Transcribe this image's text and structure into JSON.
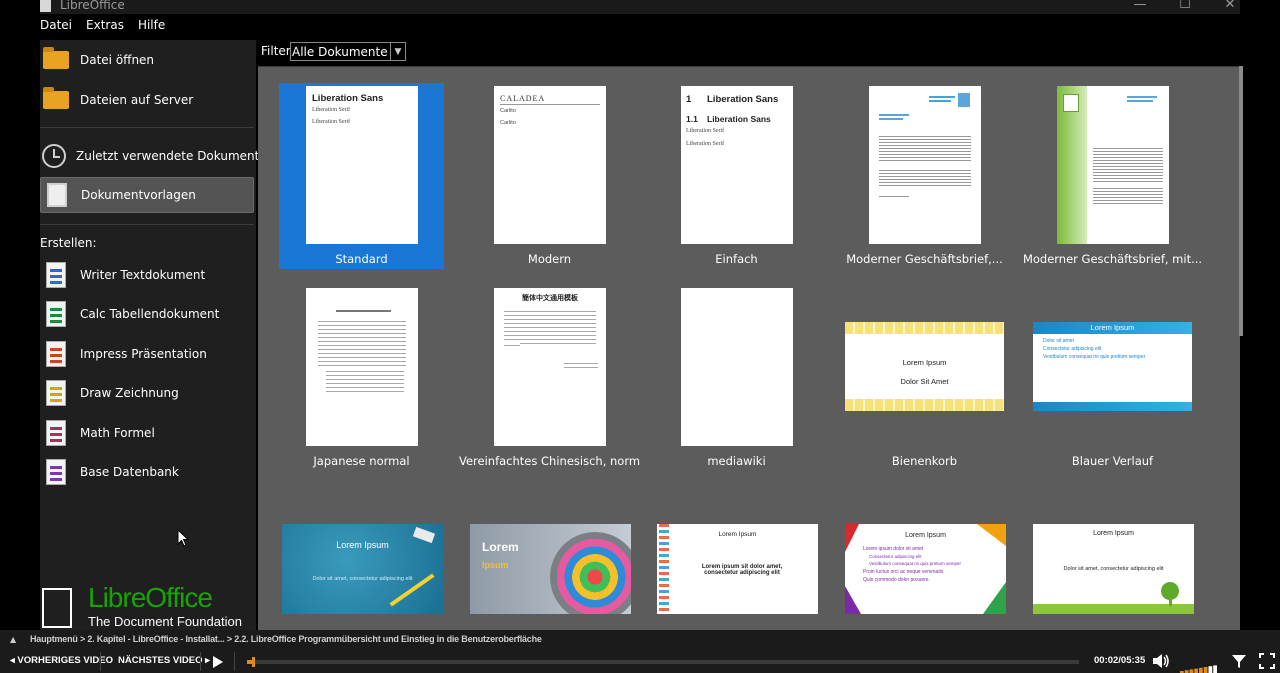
{
  "window": {
    "title": "LibreOffice",
    "minimize": "—",
    "maximize": "☐",
    "close": "✕"
  },
  "menu": [
    "Datei",
    "Extras",
    "Hilfe"
  ],
  "sidebar": {
    "open_file": "Datei öffnen",
    "remote_files": "Dateien auf Server",
    "recent": "Zuletzt verwendete Dokumente",
    "templates": "Dokumentvorlagen",
    "create_heading": "Erstellen:",
    "create": [
      {
        "label": "Writer Textdokument",
        "icon": "writer-icon",
        "color": "#2a6bc4"
      },
      {
        "label": "Calc Tabellendokument",
        "icon": "calc-icon",
        "color": "#1f8a3a"
      },
      {
        "label": "Impress Präsentation",
        "icon": "impress-icon",
        "color": "#d0431f"
      },
      {
        "label": "Draw Zeichnung",
        "icon": "draw-icon",
        "color": "#d9a400"
      },
      {
        "label": "Math Formel",
        "icon": "math-icon",
        "color": "#a0345f"
      },
      {
        "label": "Base Datenbank",
        "icon": "base-icon",
        "color": "#7b3aa3"
      }
    ],
    "logo": {
      "name": "LibreOffice",
      "subtitle": "The Document Foundation"
    }
  },
  "filter": {
    "label": "Filter:",
    "value": "Alle Dokumente"
  },
  "templates": [
    {
      "label": "Standard",
      "selected": true,
      "page": {
        "h1": "Liberation Sans",
        "l1": "Liberation Serif",
        "l2": "Liberation Serif"
      }
    },
    {
      "label": "Modern",
      "page": {
        "h1": "CALADEA",
        "l1": "Carlito",
        "l2": "Carlito"
      }
    },
    {
      "label": "Einfach",
      "page": {
        "n1": "1",
        "h1": "Liberation Sans",
        "n2": "1.1",
        "h2": "Liberation Sans",
        "l1": "Liberation Serif",
        "l2": "Liberation Serif"
      }
    },
    {
      "label": "Moderner Geschäftsbrief,..."
    },
    {
      "label": "Moderner Geschäftsbrief, mit..."
    },
    {
      "label": "Japanese normal"
    },
    {
      "label": "Vereinfachtes Chinesisch, normal",
      "page": {
        "h1": "簡体中文通用模板"
      }
    },
    {
      "label": "mediawiki"
    },
    {
      "label": "Bienenkorb",
      "slide": {
        "l1": "Lorem Ipsum",
        "l2": "Dolor Sit Amet"
      }
    },
    {
      "label": "Blauer Verlauf",
      "slide": {
        "title": "Lorem Ipsum",
        "bullets": [
          "Dolor sit amet",
          "Consectetur adipiscing elit",
          "Vestibulum consequat mi quis pretium semper"
        ]
      }
    },
    {
      "slide": {
        "title": "Lorem Ipsum",
        "sub": "Dolor sit amet, consectetur adipiscing elit"
      }
    },
    {
      "slide": {
        "title": "Lorem",
        "sub": "Ipsum"
      }
    },
    {
      "slide": {
        "title": "Lorem Ipsum",
        "sub": "Lorem ipsum sit dolor amet, consectetur adipiscing elit"
      }
    },
    {
      "slide": {
        "title": "Lorem Ipsum",
        "bullets": [
          "Lorem ipsum dolor sit amet",
          "Consectetur adipiscing elit",
          "Vestibulum consequat mi quis pretium semper",
          "Proin luctus orci ac neque venenatis",
          "Quis commodo dolor posuere."
        ]
      }
    },
    {
      "slide": {
        "title": "Lorem Ipsum",
        "sub": "Dolor sit amet, consectetur adipiscing elit"
      }
    }
  ],
  "player": {
    "breadcrumb": "Hauptmenü > 2. Kapitel - LibreOffice - Installat... > 2.2. LibreOffice Programmübersicht und Einstieg in die Benutzeroberfläche",
    "prev": "◂ VORHERIGES VIDEO",
    "next": "NÄCHSTES VIDEO ▸",
    "time": "00:02/05:35",
    "progress": 0.006,
    "volume": 0.75,
    "accent": "#e08a1e"
  }
}
